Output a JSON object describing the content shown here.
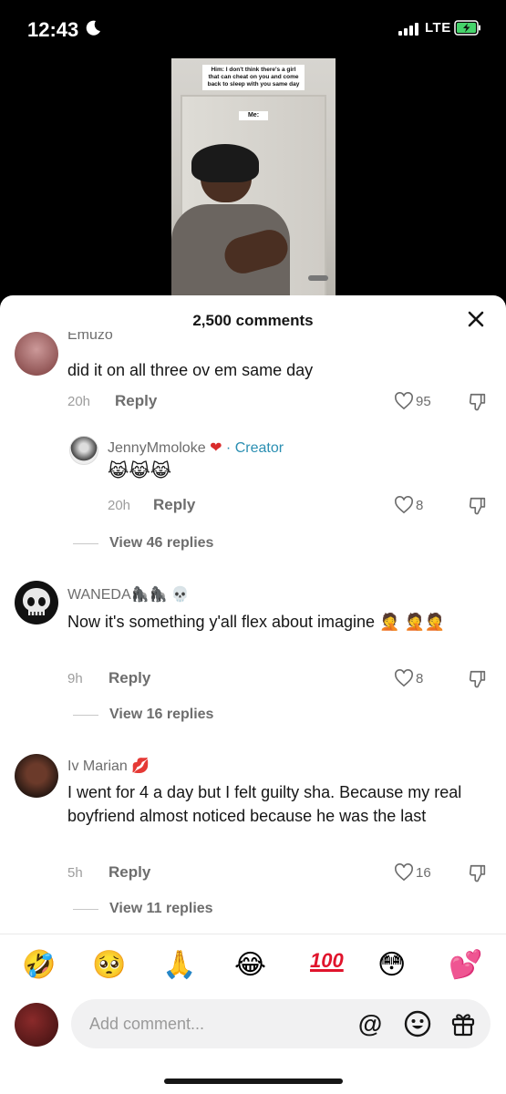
{
  "status_bar": {
    "time": "12:43",
    "network": "LTE"
  },
  "video": {
    "caption": "Him: I don't think there's a girl that can cheat on you and come back to sleep with you same day",
    "label": "Me:"
  },
  "sheet": {
    "title": "2,500 comments"
  },
  "comments": [
    {
      "username": "Emuzo",
      "text": "did it on all three ov em same day",
      "time": "20h",
      "reply_label": "Reply",
      "likes": "95"
    },
    {
      "username": "JennyMmoloke",
      "creator_label": "· Creator",
      "text": "😹😹😹",
      "time": "20h",
      "reply_label": "Reply",
      "likes": "8",
      "view_replies": "View 46 replies"
    },
    {
      "username": "WANEDA🦍🦍 💀",
      "text": "Now it's something y'all flex about imagine 🤦 🤦🤦",
      "time": "9h",
      "reply_label": "Reply",
      "likes": "8",
      "view_replies": "View 16 replies"
    },
    {
      "username": "Iv Marian 💋",
      "text": "I went for 4 a day but I felt guilty sha. Because my real boyfriend almost noticed because he was the last",
      "time": "5h",
      "reply_label": "Reply",
      "likes": "16",
      "view_replies": "View 11 replies"
    }
  ],
  "emoji_bar": [
    "🤣",
    "🥺",
    "🙏",
    "😂",
    "100",
    "😳",
    "💕"
  ],
  "input": {
    "placeholder": "Add comment..."
  },
  "colors": {
    "creator": "#2b8fb2",
    "text": "#161616",
    "muted": "#6d6d6d"
  }
}
